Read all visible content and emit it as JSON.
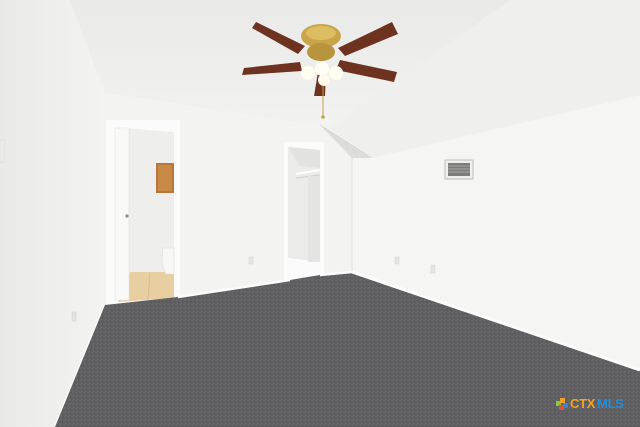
{
  "scene": {
    "kind": "photo-empty-bedroom",
    "elements": [
      "textured-vaulted-ceiling",
      "ceiling-fan-with-light",
      "white-walls",
      "gray-carpet",
      "bathroom-doorway",
      "walk-in-closet-doorway",
      "hvac-vent",
      "wall-outlets"
    ]
  },
  "colors": {
    "wall_main": "#f4f4f3",
    "wall_shadow": "#e6e6e4",
    "ceiling": "#f1f1f0",
    "carpet": "#5f5f61",
    "fan_blade": "#6e3220",
    "fan_brass": "#c9a54a",
    "bath_floor": "#e8cfa2",
    "mirror_frame": "#b8763a"
  },
  "watermark": {
    "brand_a": "CTX",
    "brand_b": "MLS",
    "color_a": "#f2a229",
    "color_b": "#2a8bd6"
  }
}
